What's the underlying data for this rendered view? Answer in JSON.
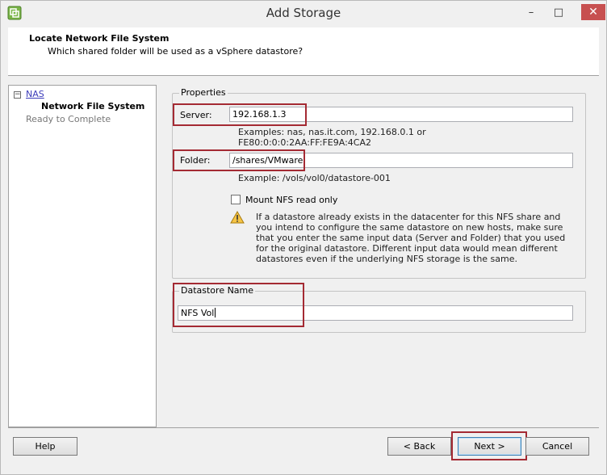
{
  "window": {
    "title": "Add Storage",
    "minimize": "–",
    "maximize": "□",
    "close": "✕"
  },
  "header": {
    "title": "Locate Network File System",
    "subtitle": "Which shared folder will be used as a vSphere datastore?"
  },
  "nav": {
    "collapse": "−",
    "items": [
      {
        "label": "NAS"
      },
      {
        "label": "Network File System"
      },
      {
        "label": "Ready to Complete"
      }
    ]
  },
  "properties": {
    "legend": "Properties",
    "server_label": "Server:",
    "server_value": "192.168.1.3",
    "server_hint_1": "Examples: nas, nas.it.com, 192.168.0.1 or",
    "server_hint_2": "FE80:0:0:0:2AA:FF:FE9A:4CA2",
    "folder_label": "Folder:",
    "folder_value": "/shares/VMware",
    "folder_hint": "Example: /vols/vol0/datastore-001",
    "readonly_label": "Mount NFS read only",
    "warning": "If a datastore already exists in the datacenter for this NFS share and you intend to configure the same datastore on new hosts, make sure that you enter the same input data (Server and Folder) that you used for the original datastore. Different input data would mean different datastores even if the underlying NFS storage is the same."
  },
  "datastore": {
    "legend": "Datastore Name",
    "value": "NFS Vol"
  },
  "buttons": {
    "help": "Help",
    "back": "< Back",
    "next": "Next >",
    "cancel": "Cancel"
  },
  "colors": {
    "highlight": "#a42a33",
    "link": "#3b3bba",
    "close": "#c75050"
  }
}
